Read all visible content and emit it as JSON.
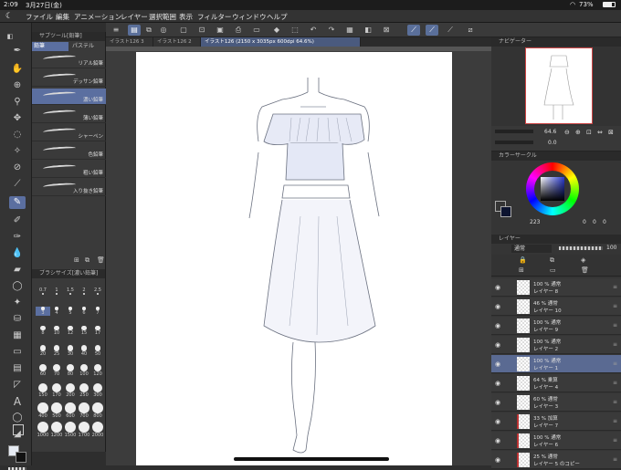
{
  "status": {
    "time": "2:09",
    "date": "3月27日(金)",
    "battery": "73%",
    "wifi": "wifi-icon"
  },
  "menu": [
    "ファイル",
    "編集",
    "アニメーション",
    "レイヤー",
    "選択範囲",
    "表示",
    "フィルター",
    "ウィンドウ",
    "ヘルプ"
  ],
  "subtool": {
    "panel_title": "サブツール[鉛筆]",
    "tabs": [
      "鉛筆",
      "パステル"
    ],
    "brushes": [
      "リアル鉛筆",
      "デッサン鉛筆",
      "濃い鉛筆",
      "薄い鉛筆",
      "シャーペン",
      "色鉛筆",
      "粗い鉛筆",
      "入り抜き鉛筆"
    ],
    "selected": "濃い鉛筆"
  },
  "brushsize": {
    "panel_title": "ブラシサイズ[濃い鉛筆]",
    "sizes": [
      "0.7",
      "1",
      "1.5",
      "2",
      "2.5",
      "3",
      "4",
      "5",
      "6",
      "7",
      "8",
      "10",
      "12",
      "15",
      "17",
      "20",
      "25",
      "30",
      "40",
      "50",
      "60",
      "70",
      "80",
      "100",
      "120",
      "150",
      "170",
      "200",
      "250",
      "300",
      "400",
      "500",
      "600",
      "700",
      "800",
      "1000",
      "1200",
      "1500",
      "1700",
      "2000"
    ],
    "selected": "3"
  },
  "tabs": [
    "イラスト126 3",
    "イラスト126 2",
    "イラスト126 (2150 x 3035px 600dpi 64.6%)"
  ],
  "navigator": {
    "title": "ナビゲーター",
    "zoom": "64.6",
    "rotation": "0.0"
  },
  "color": {
    "title": "カラーサークル",
    "value": "223",
    "rgb_labels": [
      "0",
      "0",
      "0"
    ],
    "foreground": "#0d1430",
    "background": "#ffffff"
  },
  "layers": {
    "title": "レイヤー",
    "blend": "通常",
    "opacity": "100",
    "items": [
      {
        "pct": "100 % 通常",
        "name": "レイヤー 8",
        "sel": false,
        "red": false
      },
      {
        "pct": "46 % 通常",
        "name": "レイヤー 10",
        "sel": false,
        "red": false
      },
      {
        "pct": "100 % 通常",
        "name": "レイヤー 9",
        "sel": false,
        "red": false
      },
      {
        "pct": "100 % 通常",
        "name": "レイヤー 2",
        "sel": false,
        "red": false
      },
      {
        "pct": "100 % 通常",
        "name": "レイヤー 1",
        "sel": true,
        "red": false
      },
      {
        "pct": "64 % 乗算",
        "name": "レイヤー 4",
        "sel": false,
        "red": false
      },
      {
        "pct": "60 % 通常",
        "name": "レイヤー 3",
        "sel": false,
        "red": false
      },
      {
        "pct": "33 % 加算",
        "name": "レイヤー 7",
        "sel": false,
        "red": true
      },
      {
        "pct": "100 % 通常",
        "name": "レイヤー 6",
        "sel": false,
        "red": true
      },
      {
        "pct": "25 % 通常",
        "name": "レイヤー 5 のコピー",
        "sel": false,
        "red": true
      }
    ]
  }
}
